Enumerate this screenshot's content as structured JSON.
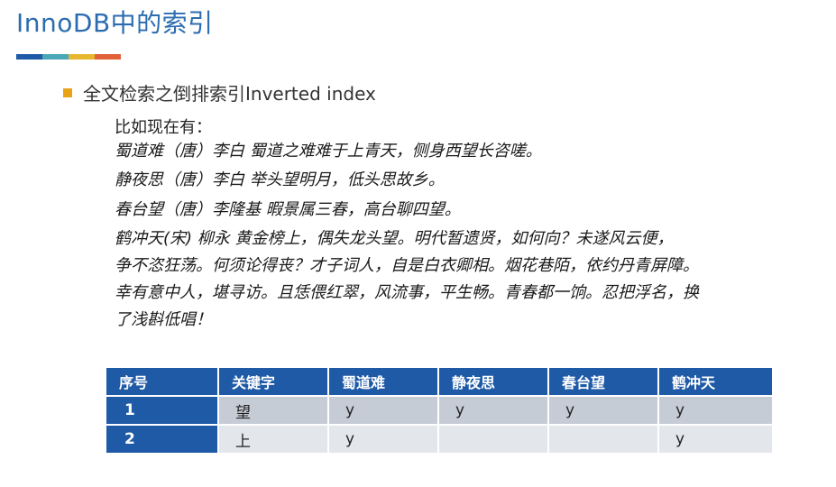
{
  "slide": {
    "title": "InnoDB中的索引",
    "bar_colors": [
      "#1f5aa6",
      "#4aa8b8",
      "#e8b730",
      "#e0613a"
    ],
    "bullet": "全文检索之倒排索引Inverted index",
    "intro": "比如现在有：",
    "poems": [
      "蜀道难（唐）李白   蜀道之难难于上青天，侧身西望长咨嗟。",
      "静夜思（唐）李白   举头望明月，低头思故乡。",
      "春台望（唐）李隆基    暇景属三春，高台聊四望。"
    ],
    "long_poem_lines": [
      "鹤冲天(宋)  柳永 黄金榜上，偶失龙头望。明代暂遗贤，如何向？未遂风云便，",
      "争不恣狂荡。何须论得丧？才子词人，自是白衣卿相。烟花巷陌，依约丹青屏障。",
      "幸有意中人，堪寻访。且恁偎红翠，风流事，平生畅。青春都一饷。忍把浮名，换",
      "了浅斟低唱！"
    ]
  },
  "table": {
    "headers": [
      "序号",
      "关键字",
      "蜀道难",
      "静夜思",
      "春台望",
      "鹤冲天"
    ],
    "rows": [
      [
        "1",
        "望",
        "y",
        "y",
        "y",
        "y"
      ],
      [
        "2",
        "上",
        "y",
        "",
        "",
        "y"
      ]
    ]
  }
}
